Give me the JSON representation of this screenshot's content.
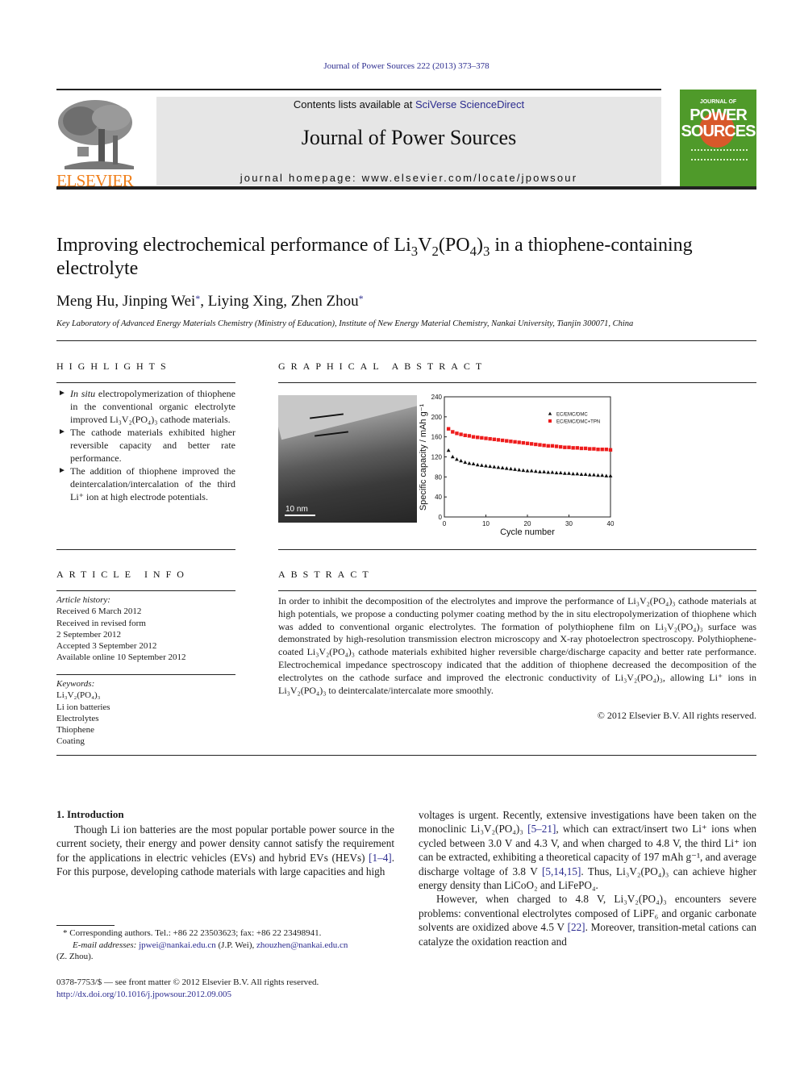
{
  "header": {
    "citation": "Journal of Power Sources 222 (2013) 373–378",
    "contents_prefix": "Contents lists available at ",
    "contents_link": "SciVerse ScienceDirect",
    "journal_title": "Journal of Power Sources",
    "homepage": "journal homepage: www.elsevier.com/locate/jpowsour",
    "publisher_logo_text": "ELSEVIER",
    "cover": {
      "line1": "JOURNAL OF",
      "line2": "POWER",
      "line3": "SOURCES"
    }
  },
  "article": {
    "title_parts": {
      "t1": "Improving electrochemical performance of Li",
      "s1": "3",
      "t2": "V",
      "s2": "2",
      "t3": "(PO",
      "s3": "4",
      "t4": ")",
      "s4": "3",
      "t5": " in a thiophene-containing electrolyte"
    },
    "authors": [
      {
        "name": "Meng Hu",
        "corresponding": false
      },
      {
        "name": "Jinping Wei",
        "corresponding": true
      },
      {
        "name": "Liying Xing",
        "corresponding": false
      },
      {
        "name": "Zhen Zhou",
        "corresponding": true
      }
    ],
    "affiliation": "Key Laboratory of Advanced Energy Materials Chemistry (Ministry of Education), Institute of New Energy Material Chemistry, Nankai University, Tianjin 300071, China"
  },
  "highlights": {
    "heading": "HIGHLIGHTS",
    "items": [
      {
        "lead_italic": "In situ",
        "text": " electropolymerization of thiophene in the conventional organic electrolyte improved Li₃V₂(PO₄)₃ cathode materials."
      },
      {
        "lead_italic": "",
        "text": "The cathode materials exhibited higher reversible capacity and better rate performance."
      },
      {
        "lead_italic": "",
        "text": "The addition of thiophene improved the deintercalation/intercalation of the third Li⁺ ion at high electrode potentials."
      }
    ]
  },
  "graphical_abstract": {
    "heading": "GRAPHICAL ABSTRACT",
    "tem_scale_label": "10 nm"
  },
  "chart_data": {
    "type": "scatter",
    "title": "",
    "xlabel": "Cycle number",
    "ylabel": "Specific capacity / mAh g⁻¹",
    "xlim": [
      0,
      40
    ],
    "ylim": [
      0,
      240
    ],
    "xticks": [
      0,
      10,
      20,
      30,
      40
    ],
    "yticks": [
      0,
      40,
      80,
      120,
      160,
      200,
      240
    ],
    "grid": false,
    "legend_position": "top-right",
    "x": [
      1,
      2,
      3,
      4,
      5,
      6,
      7,
      8,
      9,
      10,
      11,
      12,
      13,
      14,
      15,
      16,
      17,
      18,
      19,
      20,
      21,
      22,
      23,
      24,
      25,
      26,
      27,
      28,
      29,
      30,
      31,
      32,
      33,
      34,
      35,
      36,
      37,
      38,
      39,
      40
    ],
    "series": [
      {
        "name": "EC/EMC/DMC",
        "marker": "triangle",
        "color": "#111111",
        "values": [
          133,
          120,
          115,
          112,
          109,
          107,
          106,
          104,
          103,
          102,
          101,
          100,
          99,
          98,
          97,
          96,
          95,
          94,
          93,
          92,
          92,
          91,
          90,
          90,
          89,
          89,
          88,
          88,
          87,
          87,
          86,
          86,
          85,
          85,
          84,
          84,
          83,
          83,
          82,
          82
        ]
      },
      {
        "name": "EC/EMC/DMC+TPN",
        "marker": "square",
        "color": "#ee1c1c",
        "values": [
          176,
          170,
          167,
          165,
          163,
          162,
          160,
          159,
          158,
          157,
          156,
          155,
          154,
          153,
          152,
          151,
          150,
          149,
          148,
          147,
          146,
          145,
          144,
          143,
          142,
          142,
          141,
          140,
          139,
          139,
          138,
          138,
          137,
          137,
          136,
          136,
          135,
          135,
          135,
          134
        ]
      }
    ]
  },
  "article_info": {
    "heading": "ARTICLE INFO",
    "history_label": "Article history:",
    "history": [
      "Received 6 March 2012",
      "Received in revised form",
      "2 September 2012",
      "Accepted 3 September 2012",
      "Available online 10 September 2012"
    ],
    "keywords_label": "Keywords:",
    "keywords": [
      "Li₃V₂(PO₄)₃",
      "Li ion batteries",
      "Electrolytes",
      "Thiophene",
      "Coating"
    ]
  },
  "abstract": {
    "heading": "ABSTRACT",
    "text": "In order to inhibit the decomposition of the electrolytes and improve the performance of Li₃V₂(PO₄)₃ cathode materials at high potentials, we propose a conducting polymer coating method by the in situ electropolymerization of thiophene which was added to conventional organic electrolytes. The formation of polythiophene film on Li₃V₂(PO₄)₃ surface was demonstrated by high-resolution transmission electron microscopy and X-ray photoelectron spectroscopy. Polythiophene-coated Li₃V₂(PO₄)₃ cathode materials exhibited higher reversible charge/discharge capacity and better rate performance. Electrochemical impedance spectroscopy indicated that the addition of thiophene decreased the decomposition of the electrolytes on the cathode surface and improved the electronic conductivity of Li₃V₂(PO₄)₃, allowing Li⁺ ions in Li₃V₂(PO₄)₃ to deintercalate/intercalate more smoothly.",
    "copyright": "© 2012 Elsevier B.V. All rights reserved."
  },
  "introduction": {
    "heading": "1.  Introduction",
    "left_para": {
      "a": "Though Li ion batteries are the most popular portable power source in the current society, their energy and power density cannot satisfy the requirement for the applications in electric vehicles (EVs) and hybrid EVs (HEVs) ",
      "ref": "[1–4]",
      "b": ". For this purpose, developing cathode materials with large capacities and high"
    },
    "right_para1": {
      "a": "voltages is urgent. Recently, extensive investigations have been taken on the monoclinic Li₃V₂(PO₄)₃ ",
      "ref1": "[5–21]",
      "b": ", which can extract/insert two Li⁺ ions when cycled between 3.0 V and 4.3 V, and when charged to 4.8 V, the third Li⁺ ion can be extracted, exhibiting a theoretical capacity of 197 mAh g⁻¹, and average discharge voltage of 3.8 V ",
      "ref2": "[5,14,15]",
      "c": ". Thus, Li₃V₂(PO₄)₃ can achieve higher energy density than LiCoO₂ and LiFePO₄."
    },
    "right_para2": {
      "a": "However, when charged to 4.8 V, Li₃V₂(PO₄)₃ encounters severe problems: conventional electrolytes composed of LiPF₆ and organic carbonate solvents are oxidized above 4.5 V ",
      "ref": "[22]",
      "b": ". Moreover, transition-metal cations can catalyze the oxidation reaction and"
    }
  },
  "footnote": {
    "star_line": "* Corresponding authors. Tel.: +86 22 23503623; fax: +86 22 23498941.",
    "email_label": "E-mail addresses: ",
    "email1": "jpwei@nankai.edu.cn",
    "email1_who": " (J.P. Wei), ",
    "email2": "zhouzhen@nankai.edu.cn",
    "email2_who": "(Z. Zhou)."
  },
  "front_matter": {
    "issn_line": "0378-7753/$ — see front matter © 2012 Elsevier B.V. All rights reserved.",
    "doi": "http://dx.doi.org/10.1016/j.jpowsour.2012.09.005"
  }
}
